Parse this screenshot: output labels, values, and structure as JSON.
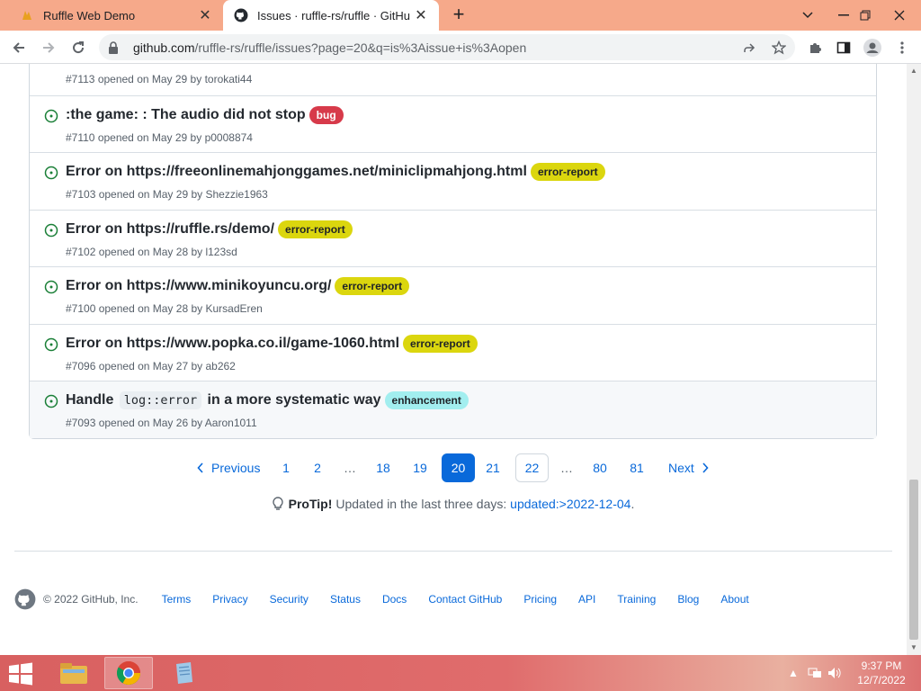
{
  "browser": {
    "tabs": [
      {
        "title": "Ruffle Web Demo",
        "active": false
      },
      {
        "title": "Issues · ruffle-rs/ruffle · GitHub",
        "active": true
      }
    ],
    "close_glyph": "✕",
    "newtab_glyph": "+",
    "url_host": "github.com",
    "url_rest": "/ruffle-rs/ruffle/issues?page=20&q=is%3Aissue+is%3Aopen"
  },
  "issues": [
    {
      "title": "",
      "labels": [],
      "meta_prefix": "#7113 opened on May 29 by ",
      "author": "torokati44"
    },
    {
      "title": ":the game: : The audio did not stop",
      "labels": [
        {
          "text": "bug",
          "bg": "#d73a4a",
          "fg": "#ffffff"
        }
      ],
      "meta_prefix": "#7110 opened on May 29 by ",
      "author": "p0008874"
    },
    {
      "title": "Error on https://freeonlinemahjonggames.net/miniclipmahjong.html",
      "labels": [
        {
          "text": "error-report",
          "bg": "#dbd60e",
          "fg": "#1f2328"
        }
      ],
      "meta_prefix": "#7103 opened on May 29 by ",
      "author": "Shezzie1963"
    },
    {
      "title": "Error on https://ruffle.rs/demo/",
      "labels": [
        {
          "text": "error-report",
          "bg": "#dbd60e",
          "fg": "#1f2328"
        }
      ],
      "meta_prefix": "#7102 opened on May 28 by ",
      "author": "l123sd"
    },
    {
      "title": "Error on https://www.minikoyuncu.org/",
      "labels": [
        {
          "text": "error-report",
          "bg": "#dbd60e",
          "fg": "#1f2328"
        }
      ],
      "meta_prefix": "#7100 opened on May 28 by ",
      "author": "KursadEren"
    },
    {
      "title": "Error on https://www.popka.co.il/game-1060.html",
      "labels": [
        {
          "text": "error-report",
          "bg": "#dbd60e",
          "fg": "#1f2328"
        }
      ],
      "meta_prefix": "#7096 opened on May 27 by ",
      "author": "ab262"
    },
    {
      "title_pre": "Handle ",
      "title_code": "log::error",
      "title_post": " in a more systematic way",
      "labels": [
        {
          "text": "enhancement",
          "bg": "#a2eeef",
          "fg": "#1f2328"
        }
      ],
      "meta_prefix": "#7093 opened on May 26 by ",
      "author": "Aaron1011"
    }
  ],
  "pagination": {
    "previous": "Previous",
    "next": "Next",
    "pages": [
      "1",
      "2",
      "…",
      "18",
      "19",
      "20",
      "21",
      "22",
      "…",
      "80",
      "81"
    ],
    "current": "20"
  },
  "protip": {
    "label": "ProTip!",
    "text": "Updated in the last three days:",
    "link": "updated:>2022-12-04",
    "suffix": "."
  },
  "footer": {
    "copyright": "© 2022 GitHub, Inc.",
    "links": [
      "Terms",
      "Privacy",
      "Security",
      "Status",
      "Docs",
      "Contact GitHub",
      "Pricing",
      "API",
      "Training",
      "Blog",
      "About"
    ]
  },
  "taskbar": {
    "time": "9:37 PM",
    "date": "12/7/2022"
  },
  "colors": {
    "accent": "#0969da",
    "open_issue": "#1a7f37",
    "titlebar": "#f6a98a"
  }
}
